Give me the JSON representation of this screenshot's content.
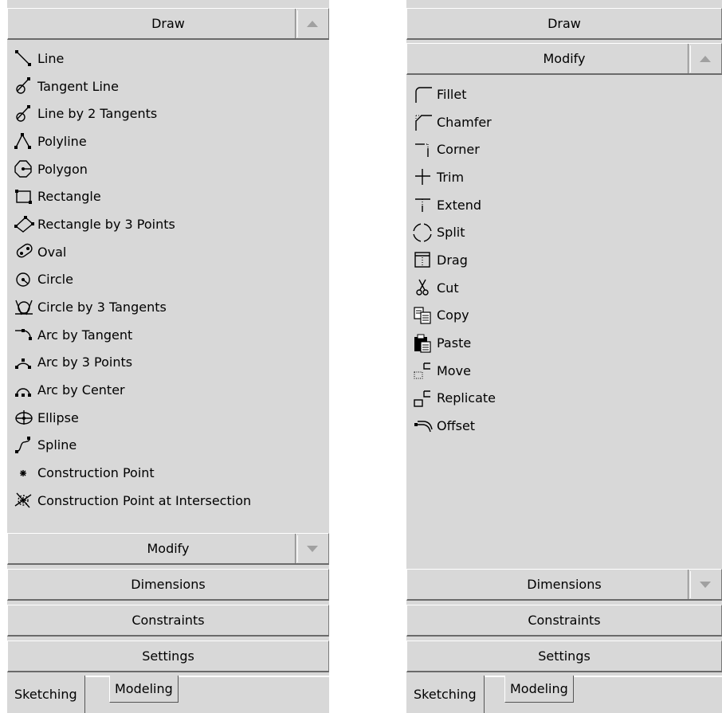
{
  "left_panel": {
    "draw_section": {
      "title": "Draw",
      "arrow": "collapse-up-arrow"
    },
    "draw_items": [
      {
        "label": "Line",
        "icon": "line-icon"
      },
      {
        "label": "Tangent Line",
        "icon": "tangent-line-icon"
      },
      {
        "label": "Line by 2 Tangents",
        "icon": "line-by-2-tangents-icon"
      },
      {
        "label": "Polyline",
        "icon": "polyline-icon"
      },
      {
        "label": "Polygon",
        "icon": "polygon-icon"
      },
      {
        "label": "Rectangle",
        "icon": "rectangle-icon"
      },
      {
        "label": "Rectangle by 3 Points",
        "icon": "rectangle-3-points-icon"
      },
      {
        "label": "Oval",
        "icon": "oval-icon"
      },
      {
        "label": "Circle",
        "icon": "circle-icon"
      },
      {
        "label": "Circle by 3 Tangents",
        "icon": "circle-3-tangents-icon"
      },
      {
        "label": "Arc by Tangent",
        "icon": "arc-by-tangent-icon"
      },
      {
        "label": "Arc by 3 Points",
        "icon": "arc-3-points-icon"
      },
      {
        "label": "Arc by Center",
        "icon": "arc-by-center-icon"
      },
      {
        "label": "Ellipse",
        "icon": "ellipse-icon"
      },
      {
        "label": "Spline",
        "icon": "spline-icon"
      },
      {
        "label": "Construction Point",
        "icon": "construction-point-icon"
      },
      {
        "label": "Construction Point at Intersection",
        "icon": "construction-point-intersection-icon"
      }
    ],
    "modify_section": {
      "title": "Modify",
      "arrow": "expand-down-arrow"
    },
    "dimensions_section": {
      "title": "Dimensions"
    },
    "constraints_section": {
      "title": "Constraints"
    },
    "settings_section": {
      "title": "Settings"
    },
    "tabs": [
      {
        "label": "Sketching",
        "active": true
      },
      {
        "label": "Modeling",
        "active": false
      }
    ]
  },
  "right_panel": {
    "draw_section": {
      "title": "Draw"
    },
    "modify_section": {
      "title": "Modify",
      "arrow": "collapse-up-arrow"
    },
    "modify_items": [
      {
        "label": "Fillet",
        "icon": "fillet-icon"
      },
      {
        "label": "Chamfer",
        "icon": "chamfer-icon"
      },
      {
        "label": "Corner",
        "icon": "corner-icon"
      },
      {
        "label": "Trim",
        "icon": "trim-icon"
      },
      {
        "label": "Extend",
        "icon": "extend-icon"
      },
      {
        "label": "Split",
        "icon": "split-icon"
      },
      {
        "label": "Drag",
        "icon": "drag-icon"
      },
      {
        "label": "Cut",
        "icon": "cut-icon"
      },
      {
        "label": "Copy",
        "icon": "copy-icon"
      },
      {
        "label": "Paste",
        "icon": "paste-icon"
      },
      {
        "label": "Move",
        "icon": "move-icon"
      },
      {
        "label": "Replicate",
        "icon": "replicate-icon"
      },
      {
        "label": "Offset",
        "icon": "offset-icon"
      }
    ],
    "dimensions_section": {
      "title": "Dimensions",
      "arrow": "expand-down-arrow"
    },
    "constraints_section": {
      "title": "Constraints"
    },
    "settings_section": {
      "title": "Settings"
    },
    "tabs": [
      {
        "label": "Sketching",
        "active": true
      },
      {
        "label": "Modeling",
        "active": false
      }
    ]
  },
  "colors": {
    "panel_bg": "#d8d8d8",
    "arrow": "#a0a0a0",
    "bevel_light": "#ffffff",
    "bevel_dark": "#6a6a6a"
  }
}
